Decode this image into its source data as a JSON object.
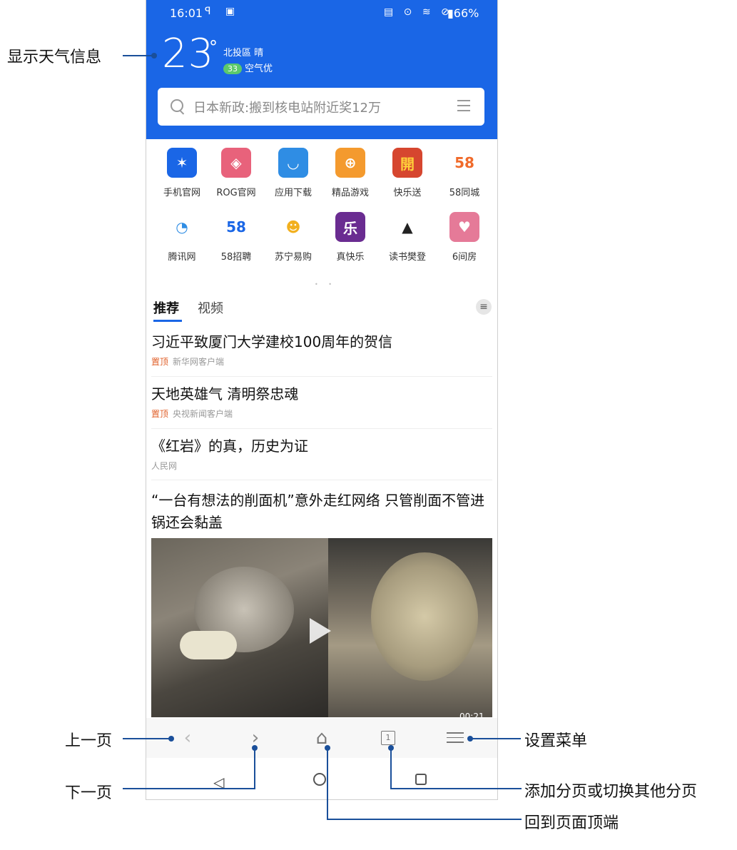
{
  "status_bar": {
    "time": "16:01",
    "left_icons": "ꟼ ▣",
    "right_icons": "▤ ⊙ ≋ ⊘",
    "battery": "▮66%"
  },
  "weather": {
    "temperature": "23",
    "degree_symbol": "°",
    "location_condition": "北投區 晴",
    "aqi_value": "33",
    "aqi_text": "空气优"
  },
  "search": {
    "placeholder": "日本新政:搬到核电站附近奖12万"
  },
  "shortcuts": [
    {
      "label": "手机官网",
      "icon": "asus-icon",
      "color": "#1a66e6",
      "glyph": "✶"
    },
    {
      "label": "ROG官网",
      "icon": "rog-icon",
      "color": "#e8627b",
      "glyph": "◈"
    },
    {
      "label": "应用下载",
      "icon": "app-store-icon",
      "color": "#2f8de4",
      "glyph": "◡"
    },
    {
      "label": "精品游戏",
      "icon": "gamepad-icon",
      "color": "#f49a2e",
      "glyph": "⊕"
    },
    {
      "label": "快乐送",
      "icon": "gift-icon",
      "color": "#d6462f",
      "glyph": "開"
    },
    {
      "label": "58同城",
      "icon": "58-icon",
      "color": "#ffffff",
      "glyph": "58"
    },
    {
      "label": "腾讯网",
      "icon": "tencent-icon",
      "color": "#ffffff",
      "glyph": "◔"
    },
    {
      "label": "58招聘",
      "icon": "58-recruit-icon",
      "color": "#ffffff",
      "glyph": "58"
    },
    {
      "label": "苏宁易购",
      "icon": "suning-icon",
      "color": "#ffffff",
      "glyph": "☻"
    },
    {
      "label": "真快乐",
      "icon": "zhenkuaile-icon",
      "color": "#6a2c91",
      "glyph": "乐"
    },
    {
      "label": "读书樊登",
      "icon": "book-icon",
      "color": "#ffffff",
      "glyph": "▲"
    },
    {
      "label": "6间房",
      "icon": "6room-icon",
      "color": "#e57a98",
      "glyph": "♥"
    }
  ],
  "page_dots": "• •",
  "tabs": {
    "recommend": "推荐",
    "video": "视频",
    "menu_glyph": "≡"
  },
  "news": [
    {
      "title": "习近平致厦门大学建校100周年的贺信",
      "pin": "置顶",
      "source": "新华网客户端"
    },
    {
      "title": "天地英雄气 清明祭忠魂",
      "pin": "置顶",
      "source": "央视新闻客户端"
    },
    {
      "title": "《红岩》的真，历史为证",
      "pin": "",
      "source": "人民网"
    },
    {
      "title": "“一台有想法的削面机”意外走红网络 只管削面不管进锅还会黏盖",
      "pin": "",
      "source": ""
    }
  ],
  "video": {
    "duration": "00:21"
  },
  "toolbar": {
    "back_glyph": "‹",
    "forward_glyph": "›",
    "home_glyph": "⌂",
    "tabs_count": "1"
  },
  "nav": {
    "back_glyph": "◁"
  },
  "annotations": {
    "weather": "显示天气信息",
    "prev": "上一页",
    "next": "下一页",
    "menu": "设置菜单",
    "tabs": "添加分页或切换其他分页",
    "home": "回到页面顶端"
  }
}
